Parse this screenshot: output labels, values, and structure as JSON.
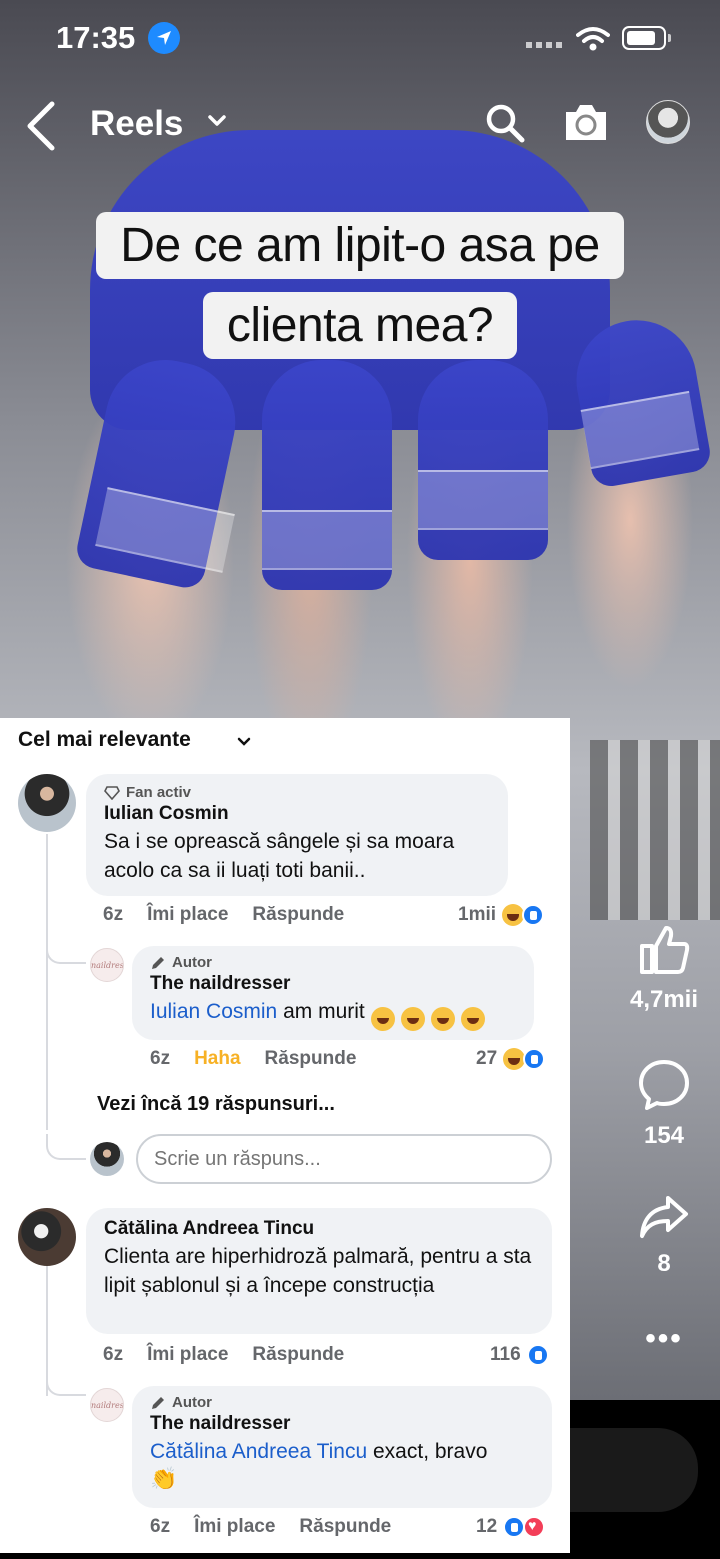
{
  "status_bar": {
    "time": "17:35"
  },
  "nav": {
    "title": "Reels"
  },
  "video": {
    "caption_line1": "De ce am lipit-o asa pe",
    "caption_line2": "clienta mea?"
  },
  "actions": {
    "likes": "4,7mii",
    "comments": "154",
    "shares": "8"
  },
  "comments": {
    "sort_label": "Cel mai relevante",
    "reply_placeholder": "Scrie un răspuns...",
    "more_replies": "Vezi încă 19 răspunsuri...",
    "items": [
      {
        "badge": "Fan activ",
        "author": "Iulian Cosmin",
        "text": "Sa i se oprească sângele și sa moara acolo ca sa ii luați toti banii..",
        "time": "6z",
        "like_label": "Îmi place",
        "reply_label": "Răspunde",
        "reactions": "1mii",
        "reply": {
          "badge": "Autor",
          "author": "The naildresser",
          "mention": "Iulian Cosmin",
          "text": "am murit",
          "emoji": [
            "🤣",
            "🤣",
            "🤣",
            "🤣"
          ],
          "time": "6z",
          "like_label": "Haha",
          "reply_label": "Răspunde",
          "reactions": "27"
        }
      },
      {
        "author": "Cătălina Andreea Tincu",
        "text": "Clienta are hiperhidroză palmară, pentru a sta lipit șablonul și a începe construcția",
        "time": "6z",
        "like_label": "Îmi place",
        "reply_label": "Răspunde",
        "reactions": "116",
        "reply": {
          "badge": "Autor",
          "author": "The naildresser",
          "mention": "Cătălina Andreea Tincu",
          "text": "exact, bravo",
          "emoji": [
            "👏"
          ],
          "time": "6z",
          "like_label": "Îmi place",
          "reply_label": "Răspunde",
          "reactions": "12"
        }
      }
    ]
  },
  "colors": {
    "accent": "#1877f2",
    "haha": "#f7b125",
    "mention": "#1b5ecb"
  }
}
